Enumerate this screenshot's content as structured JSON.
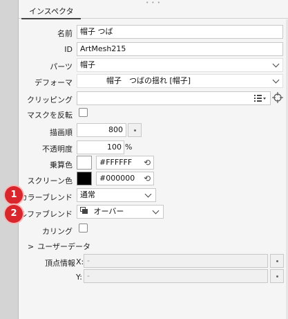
{
  "inspector": {
    "tab_label": "インスペクタ",
    "name": {
      "label": "名前",
      "value": "帽子 つば"
    },
    "id": {
      "label": "ID",
      "value": "ArtMesh215"
    },
    "parts": {
      "label": "パーツ",
      "value": "帽子"
    },
    "deformer": {
      "label": "デフォーマ",
      "value": "帽子　つばの揺れ [帽子]"
    },
    "clipping": {
      "label": "クリッピング",
      "value": ""
    },
    "invert_mask": {
      "label": "マスクを反転",
      "checked": false
    },
    "draw_order": {
      "label": "描画順",
      "value": "800"
    },
    "opacity": {
      "label": "不透明度",
      "value": "100",
      "unit": "%"
    },
    "multiply_color": {
      "label": "乗算色",
      "value": "#FFFFFF",
      "color": "#ffffff"
    },
    "screen_color": {
      "label": "スクリーン色",
      "value": "#000000",
      "color": "#000000"
    },
    "color_blend": {
      "label": "カラーブレンド",
      "value": "通常",
      "badge": "1"
    },
    "alpha_blend": {
      "label": "アルファブレンド",
      "value": "オーバー",
      "badge": "2"
    },
    "culling": {
      "label": "カリング",
      "checked": false
    },
    "user_data": {
      "label": "ユーザーデータ",
      "expander": ">"
    },
    "vertex_info": {
      "label": "頂点情報",
      "x_label": "X:",
      "y_label": "Y:",
      "x_value": "-",
      "y_value": "-"
    }
  },
  "colors": {
    "badge": "#d9262c",
    "panel_bg": "#f5f5f5"
  }
}
